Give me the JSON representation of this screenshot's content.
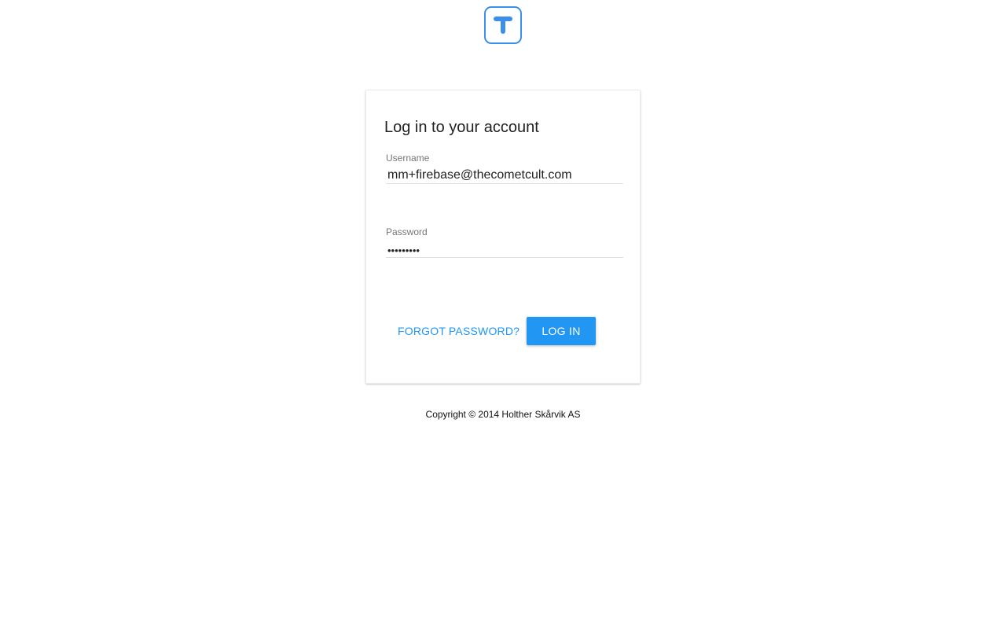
{
  "logo": {
    "icon": "t-logo-icon",
    "letter": "T",
    "color": "#3b8fea"
  },
  "login_card": {
    "title": "Log in to your account",
    "username": {
      "label": "Username",
      "value": "mm+firebase@thecometcult.com"
    },
    "password": {
      "label": "Password",
      "value": "•••••••••"
    },
    "forgot_password_label": "FORGOT PASSWORD?",
    "login_button_label": "LOG IN"
  },
  "footer": {
    "copyright": "Copyright © 2014 Holther Skårvik AS"
  },
  "colors": {
    "accent": "#2196f3",
    "logo": "#3b8fea"
  }
}
